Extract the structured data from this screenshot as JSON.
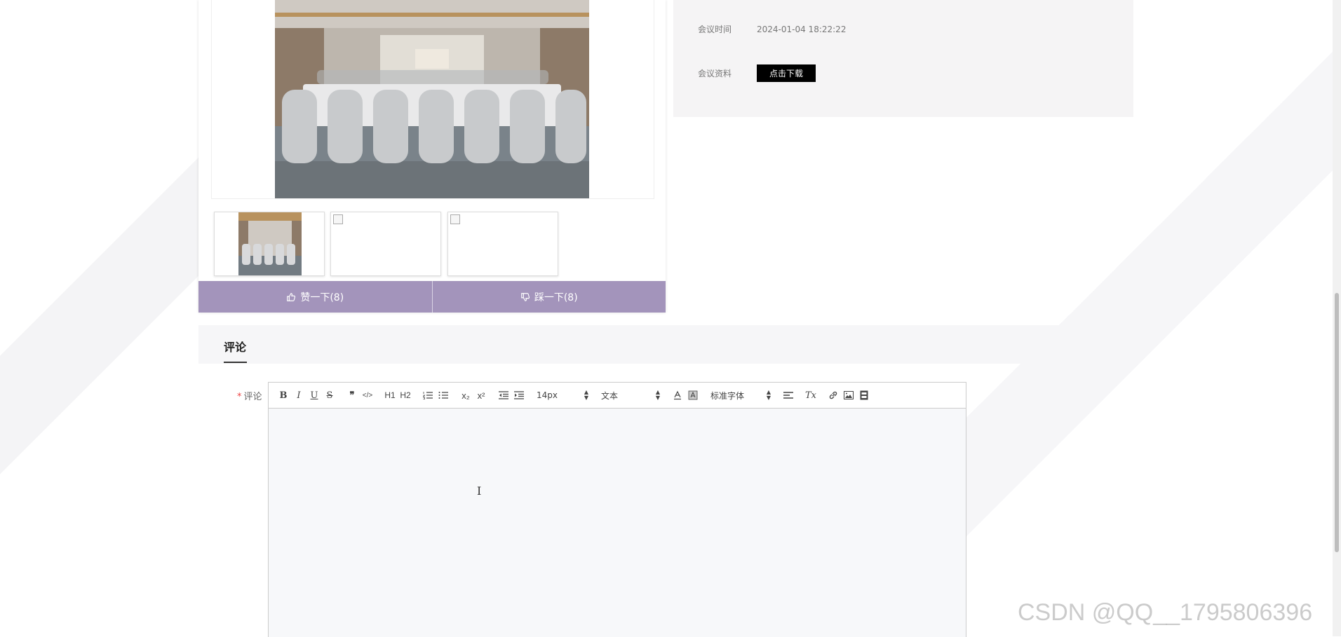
{
  "info": {
    "time_label": "会议时间",
    "time_value": "2024-01-04 18:22:22",
    "file_label": "会议资料",
    "download_label": "点击下载"
  },
  "votes": {
    "like_label": "赞一下(8)",
    "dislike_label": "踩一下(8)"
  },
  "comments": {
    "tab_title": "评论",
    "field_label": "评论",
    "required_mark": "*"
  },
  "toolbar": {
    "bold": "B",
    "italic": "I",
    "underline": "U",
    "strike": "S",
    "blockquote": "❞",
    "code": "</>",
    "h1": "H1",
    "h2": "H2",
    "subscript": "x₂",
    "superscript": "x²",
    "size_value": "14px",
    "header_value": "文本",
    "font_value": "标准字体",
    "clear": "Tx"
  },
  "watermark": "CSDN @QQ__1795806396"
}
